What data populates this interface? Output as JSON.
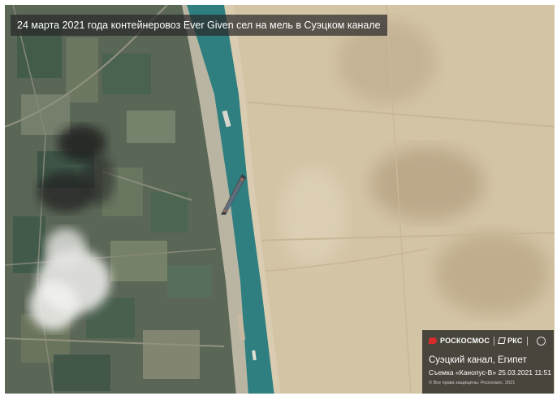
{
  "caption": {
    "text": "24 марта 2021 года контейнеровоз Ever Given сел на мель в Суэцком канале"
  },
  "credit_panel": {
    "logo_roscosmos": "РОСКОСМОС",
    "logo_rks": "РКС",
    "place": "Суэцкий канал, Египет",
    "shot_info": "Съемка «Канопус-В» 25.03.2021 11:51",
    "rights": "© Все права защищены. Роскосмос, 2021"
  },
  "colors": {
    "canal_water": "#2f7f80",
    "desert": "#d6c7a8",
    "farmland": "#5b6a55",
    "logo_red": "#d92b2b"
  }
}
